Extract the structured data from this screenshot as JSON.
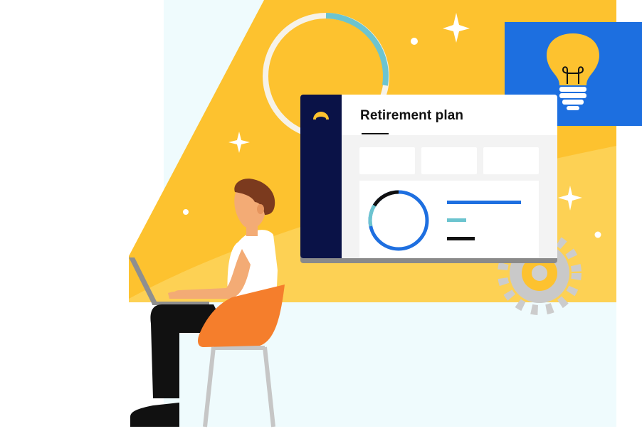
{
  "app_window": {
    "title": "Retirement plan",
    "sidebar_color": "#0a1247",
    "accent": "#1e6fe0",
    "secondary_accent": "#6cc4cf"
  },
  "scene": {
    "background_panel_color": "#effbfd",
    "backdrop_color": "#fdc22f",
    "speech_bubble_color": "#1d6fe0",
    "speech_bubble_icon": "lightbulb-icon",
    "chair_color": "#f57e2c",
    "decor_icons": [
      "sparkle-icon",
      "gear-icon",
      "ring-progress-icon"
    ]
  }
}
